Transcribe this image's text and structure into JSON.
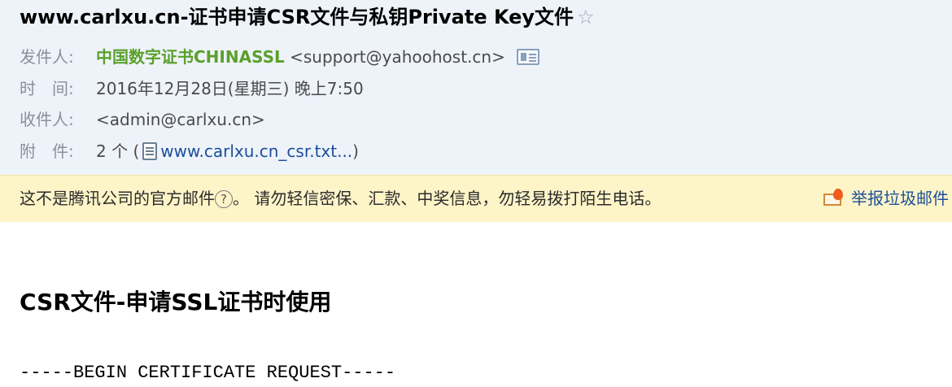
{
  "email": {
    "subject": "www.carlxu.cn-证书申请CSR文件与私钥Private Key文件",
    "star_glyph": "☆",
    "from": {
      "label": "发件人:",
      "name": "中国数字证书CHINASSL",
      "address": "<support@yahoohost.cn>",
      "card_icon": "contact-card-icon"
    },
    "time": {
      "label": "时　间:",
      "value": "2016年12月28日(星期三) 晚上7:50"
    },
    "to": {
      "label": "收件人:",
      "value": "<admin@carlxu.cn>"
    },
    "attachments": {
      "label": "附　件:",
      "count_prefix": "2 个 (",
      "file_icon": "document-icon",
      "file_name": "www.carlxu.cn_csr.txt...",
      "suffix": ")"
    }
  },
  "warning": {
    "text_before_help": "这不是腾讯公司的官方邮件",
    "help_glyph": "?",
    "text_after_help": "。  请勿轻信密保、汇款、中奖信息，勿轻易拨打陌生电话。",
    "report_icon": "report-spam-icon",
    "report_label": "举报垃圾邮件"
  },
  "body": {
    "title": "CSR文件-申请SSL证书时使用",
    "pem_begin": "-----BEGIN CERTIFICATE REQUEST-----"
  },
  "colors": {
    "header_bg": "#eef3fa",
    "sender_green": "#5aa02c",
    "link_blue": "#1b4e9a",
    "warning_bg": "#fdf4c8"
  }
}
